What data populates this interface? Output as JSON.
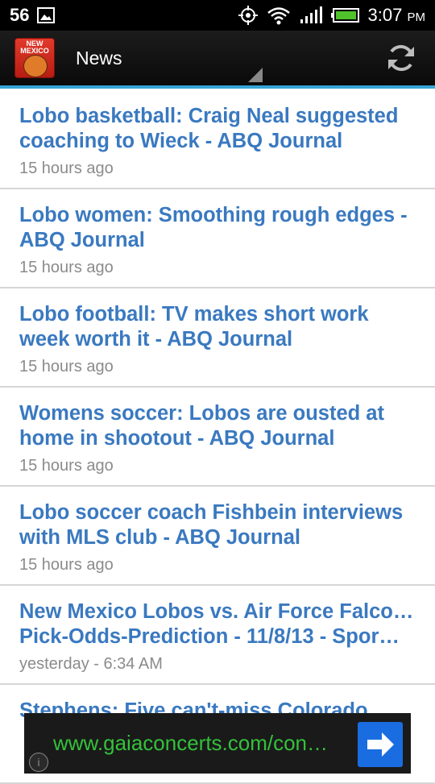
{
  "status_bar": {
    "notification_count": "56",
    "time": "3:07",
    "ampm": "PM",
    "icons": [
      "picture-icon",
      "gps-icon",
      "wifi-icon",
      "signal-icon",
      "battery-icon"
    ]
  },
  "action_bar": {
    "logo_text": "NEW MEXICO",
    "title": "News",
    "refresh_icon": "refresh-icon"
  },
  "news": [
    {
      "title": "Lobo basketball: Craig Neal suggested coaching to Wieck - ABQ Journal",
      "time": "15 hours ago"
    },
    {
      "title": "Lobo women: Smoothing rough edges - ABQ Journal",
      "time": "15 hours ago"
    },
    {
      "title": "Lobo football: TV makes short work week worth it - ABQ Journal",
      "time": "15 hours ago"
    },
    {
      "title": "Womens soccer: Lobos are ousted at home in shootout - ABQ Journal",
      "time": "15 hours ago"
    },
    {
      "title": "Lobo soccer coach Fishbein interviews with MLS club - ABQ Journal",
      "time": "15 hours ago"
    },
    {
      "title_line1": "New Mexico Lobos vs. Air Force Falcons",
      "title_line2": "Pick-Odds-Prediction - 11/8/13 - Spor…",
      "time": "yesterday - 6:34 AM"
    },
    {
      "title": "Stephens: Five can't-miss Colorado"
    }
  ],
  "ad": {
    "url": "www.gaiaconcerts.com/con…",
    "info_icon": "info-icon",
    "arrow_icon": "arrow-right-icon"
  },
  "colors": {
    "accent": "#36a5d6",
    "link": "#3a79c0",
    "ad_text": "#33c23a",
    "ad_button": "#1a6de0"
  }
}
